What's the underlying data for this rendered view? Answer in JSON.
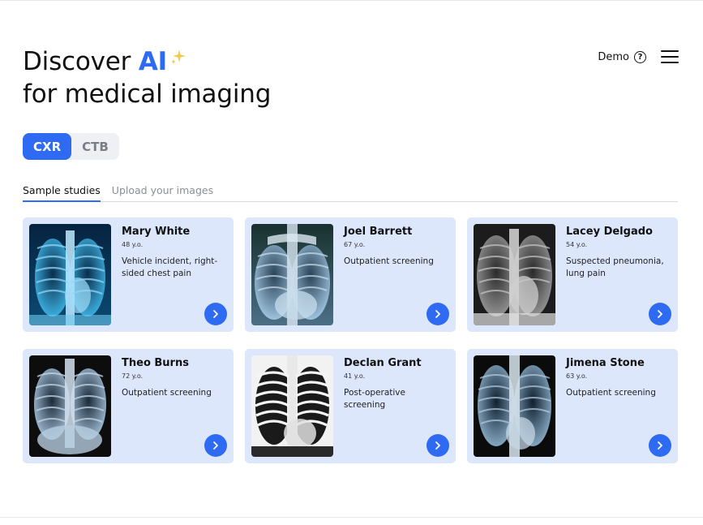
{
  "header": {
    "title_part1": "Discover ",
    "title_ai": "AI",
    "title_line2": "for medical imaging",
    "demo_label": "Demo",
    "help_symbol": "?",
    "sparkle_icon": "sparkle-icon",
    "help_icon": "question-circle-icon",
    "menu_icon": "hamburger-menu-icon"
  },
  "modality": {
    "options": [
      "CXR",
      "CTB"
    ],
    "selected": "CXR"
  },
  "tabs": [
    {
      "label": "Sample studies",
      "active": true
    },
    {
      "label": "Upload your images",
      "active": false
    }
  ],
  "studies": [
    {
      "name": "Mary White",
      "age": "48 y.o.",
      "desc": "Vehicle incident, right-sided chest pain"
    },
    {
      "name": "Joel Barrett",
      "age": "67 y.o.",
      "desc": "Outpatient screening"
    },
    {
      "name": "Lacey Delgado",
      "age": "54 y.o.",
      "desc": "Suspected pneumonia, lung pain"
    },
    {
      "name": "Theo Burns",
      "age": "72 y.o.",
      "desc": "Outpatient screening"
    },
    {
      "name": "Declan Grant",
      "age": "41 y.o.",
      "desc": "Post-operative screening"
    },
    {
      "name": "Jimena Stone",
      "age": "63 y.o.",
      "desc": "Outpatient screening"
    }
  ],
  "colors": {
    "accent": "#2f6bf2",
    "card_bg": "#dde7fc",
    "sparkle": "#f2c94c"
  }
}
